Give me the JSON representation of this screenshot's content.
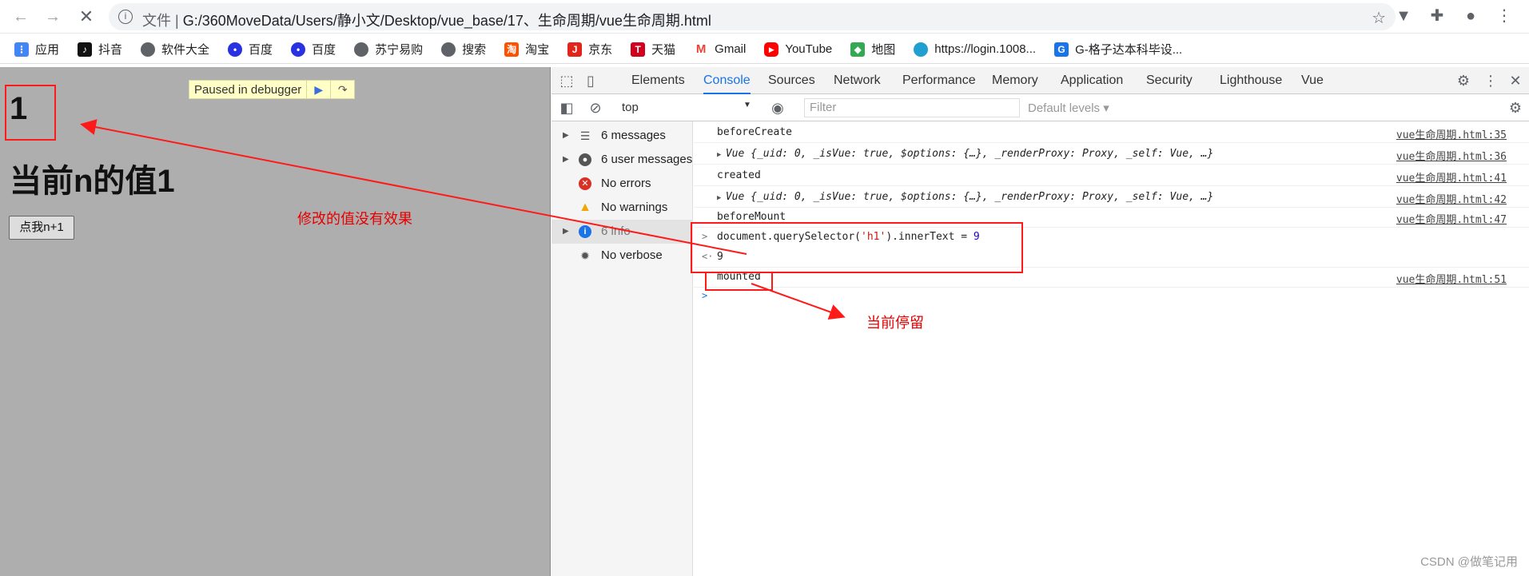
{
  "browser": {
    "url_prefix": "文件",
    "url": "G:/360MoveData/Users/静小文/Desktop/vue_base/17、生命周期/vue生命周期.html"
  },
  "bookmarks": [
    {
      "label": "应用",
      "icon": "apps-grid-icon",
      "color": "#4285f4"
    },
    {
      "label": "抖音",
      "icon": "tiktok-icon",
      "color": "#111111"
    },
    {
      "label": "软件大全",
      "icon": "globe-icon",
      "color": "#5f6368"
    },
    {
      "label": "百度",
      "icon": "baidu-paw-icon",
      "color": "#2932e1"
    },
    {
      "label": "百度",
      "icon": "baidu-paw-icon",
      "color": "#2932e1"
    },
    {
      "label": "苏宁易购",
      "icon": "globe-icon",
      "color": "#5f6368"
    },
    {
      "label": "搜索",
      "icon": "globe-icon",
      "color": "#5f6368"
    },
    {
      "label": "淘宝",
      "icon": "taobao-icon",
      "color": "#ff5000"
    },
    {
      "label": "京东",
      "icon": "jd-icon",
      "color": "#e1251b"
    },
    {
      "label": "天猫",
      "icon": "tmall-icon",
      "color": "#d1001c"
    },
    {
      "label": "Gmail",
      "icon": "gmail-icon",
      "color": "#ea4335"
    },
    {
      "label": "YouTube",
      "icon": "youtube-icon",
      "color": "#ff0000"
    },
    {
      "label": "地图",
      "icon": "map-icon",
      "color": "#34a853"
    },
    {
      "label": "https://login.1008...",
      "icon": "globe-icon",
      "color": "#20a0d0"
    },
    {
      "label": "G-格子达本科毕设...",
      "icon": "gezida-icon",
      "color": "#1a73e8"
    }
  ],
  "page": {
    "h1_number": "1",
    "h1_value": "当前n的值1",
    "button_label": "点我n+1",
    "paused_label": "Paused in debugger"
  },
  "annotations": {
    "note_no_effect": "修改的值没有效果",
    "note_current_stop": "当前停留"
  },
  "devtools": {
    "tabs": [
      "Elements",
      "Console",
      "Sources",
      "Network",
      "Performance",
      "Memory",
      "Application",
      "Security",
      "Lighthouse",
      "Vue"
    ],
    "active_tab": "Console",
    "context": "top",
    "filter_placeholder": "Filter",
    "levels": "Default levels ▾",
    "sidebar": [
      {
        "label": "6 messages",
        "icon": "list-icon"
      },
      {
        "label": "6 user messages",
        "icon": "user-icon"
      },
      {
        "label": "No errors",
        "icon": "error-icon"
      },
      {
        "label": "No warnings",
        "icon": "warning-icon"
      },
      {
        "label": "6 info",
        "icon": "info-icon"
      },
      {
        "label": "No verbose",
        "icon": "bug-icon"
      }
    ],
    "console": {
      "beforeCreate": "beforeCreate",
      "vue_obj_a": "Vue {_uid: 0, _isVue: true, $options: {…}, _renderProxy: Proxy, _self: Vue, …}",
      "created": "created",
      "vue_obj_b": "Vue {_uid: 0, _isVue: true, $options: {…}, _renderProxy: Proxy, _self: Vue, …}",
      "beforeMount": "beforeMount",
      "command_a": "document.querySelector(",
      "command_str": "'h1'",
      "command_b": ").innerText = ",
      "command_num": "9",
      "result": "9",
      "mounted": "mounted",
      "src_35": "vue生命周期.html:35",
      "src_36": "vue生命周期.html:36",
      "src_41": "vue生命周期.html:41",
      "src_42": "vue生命周期.html:42",
      "src_47": "vue生命周期.html:47",
      "src_51": "vue生命周期.html:51"
    }
  },
  "watermark": "CSDN @做笔记用"
}
